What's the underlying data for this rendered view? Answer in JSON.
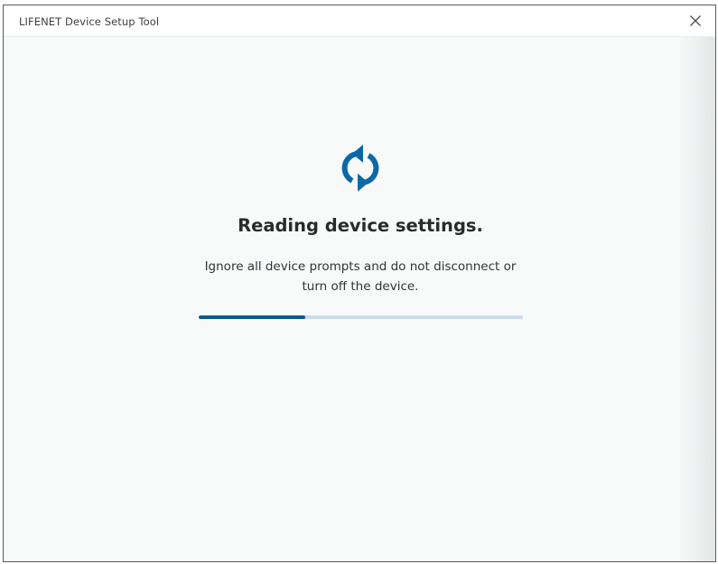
{
  "window": {
    "title": "LIFENET Device Setup Tool",
    "close_icon": "close-icon"
  },
  "status": {
    "icon": "sync-icon",
    "heading": "Reading device settings.",
    "message": "Ignore all device prompts and do not disconnect or turn off the device.",
    "progress_fraction": 0.33
  },
  "colors": {
    "accent": "#0d68a8",
    "progress_fill": "#0d5a8e",
    "progress_track": "#c9ddef",
    "background": "#f8fafa"
  }
}
